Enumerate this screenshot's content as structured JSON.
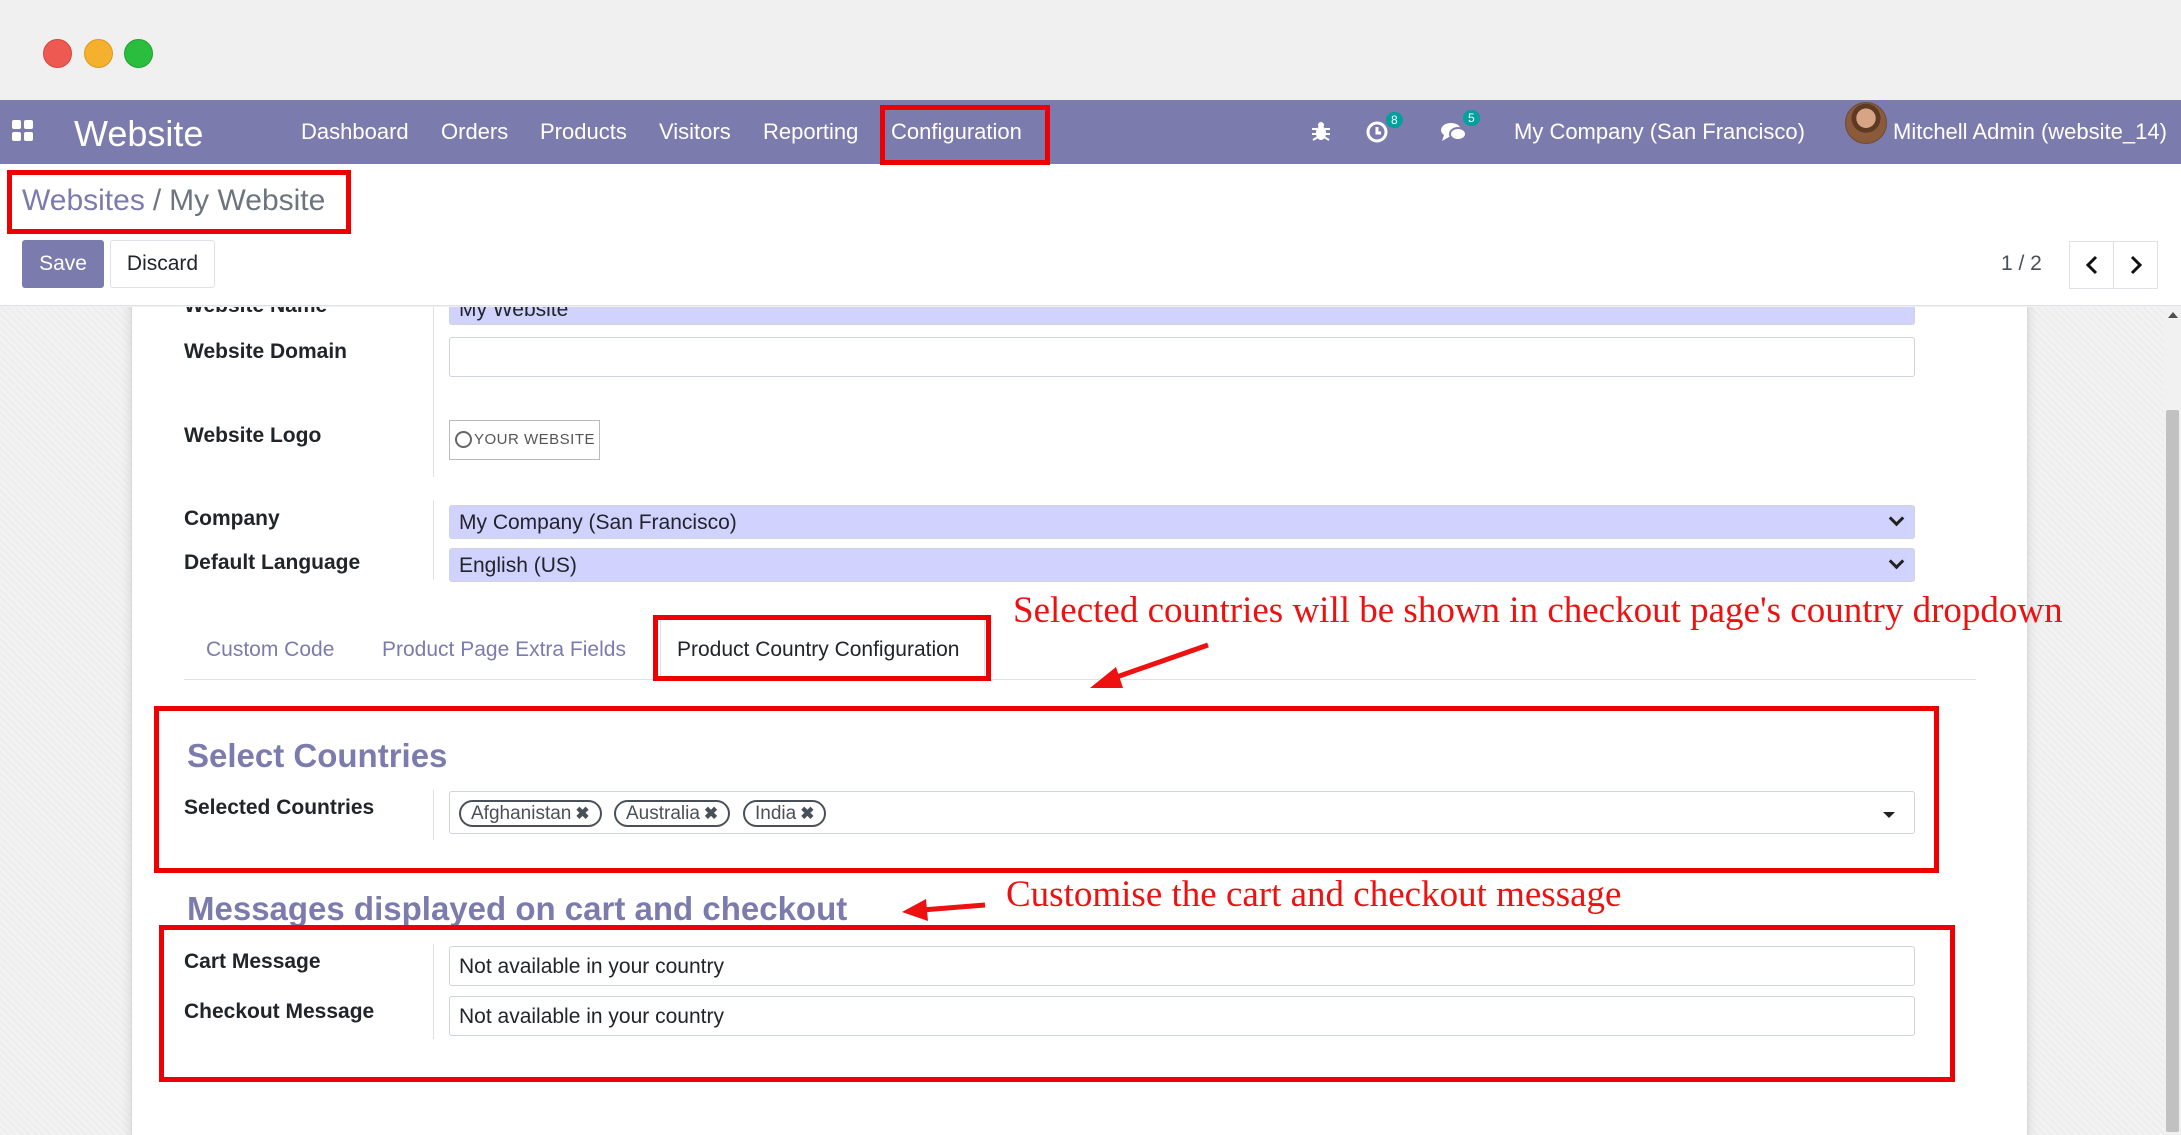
{
  "window": {
    "controls": [
      "close",
      "minimize",
      "maximize"
    ]
  },
  "navbar": {
    "apps_icon": "apps-grid-icon",
    "app_title": "Website",
    "menu": [
      "Dashboard",
      "Orders",
      "Products",
      "Visitors",
      "Reporting",
      "Configuration"
    ],
    "debug_icon": "bug-icon",
    "activity_icon": "clock-icon",
    "activity_count": "8",
    "messages_icon": "chat-icon",
    "messages_count": "5",
    "company": "My Company (San Francisco)",
    "user": "Mitchell Admin (website_14)"
  },
  "control_panel": {
    "breadcrumb_parent": "Websites",
    "breadcrumb_separator": "/",
    "breadcrumb_current": "My Website",
    "save_label": "Save",
    "discard_label": "Discard",
    "pager": "1 / 2",
    "prev_icon": "chevron-left-icon",
    "next_icon": "chevron-right-icon"
  },
  "form": {
    "website_name_label": "Website Name",
    "website_name_value": "My Website",
    "website_domain_label": "Website Domain",
    "website_domain_value": "",
    "website_logo_label": "Website Logo",
    "website_logo_text": "YOUR WEBSITE",
    "company_label": "Company",
    "company_value": "My Company (San Francisco)",
    "default_language_label": "Default Language",
    "default_language_value": "English (US)",
    "tabs": [
      "Custom Code",
      "Product Page Extra Fields",
      "Product Country Configuration"
    ],
    "active_tab": "Product Country Configuration",
    "select_countries_title": "Select Countries",
    "selected_countries_label": "Selected Countries",
    "selected_countries": [
      "Afghanistan",
      "Australia",
      "India"
    ],
    "tag_remove_glyph": "✖",
    "messages_title": "Messages displayed on cart and checkout",
    "cart_message_label": "Cart Message",
    "cart_message_value": "Not available in your country",
    "checkout_message_label": "Checkout Message",
    "checkout_message_value": "Not available in your country"
  },
  "annotations": {
    "note_countries": "Selected countries will be shown in checkout page's country dropdown",
    "note_messages": "Customise the cart and checkout message",
    "highlight_color": "#ee0000"
  },
  "colors": {
    "brand": "#7c7bad",
    "required_field": "#d2d2ff",
    "badge": "#00a09d"
  }
}
